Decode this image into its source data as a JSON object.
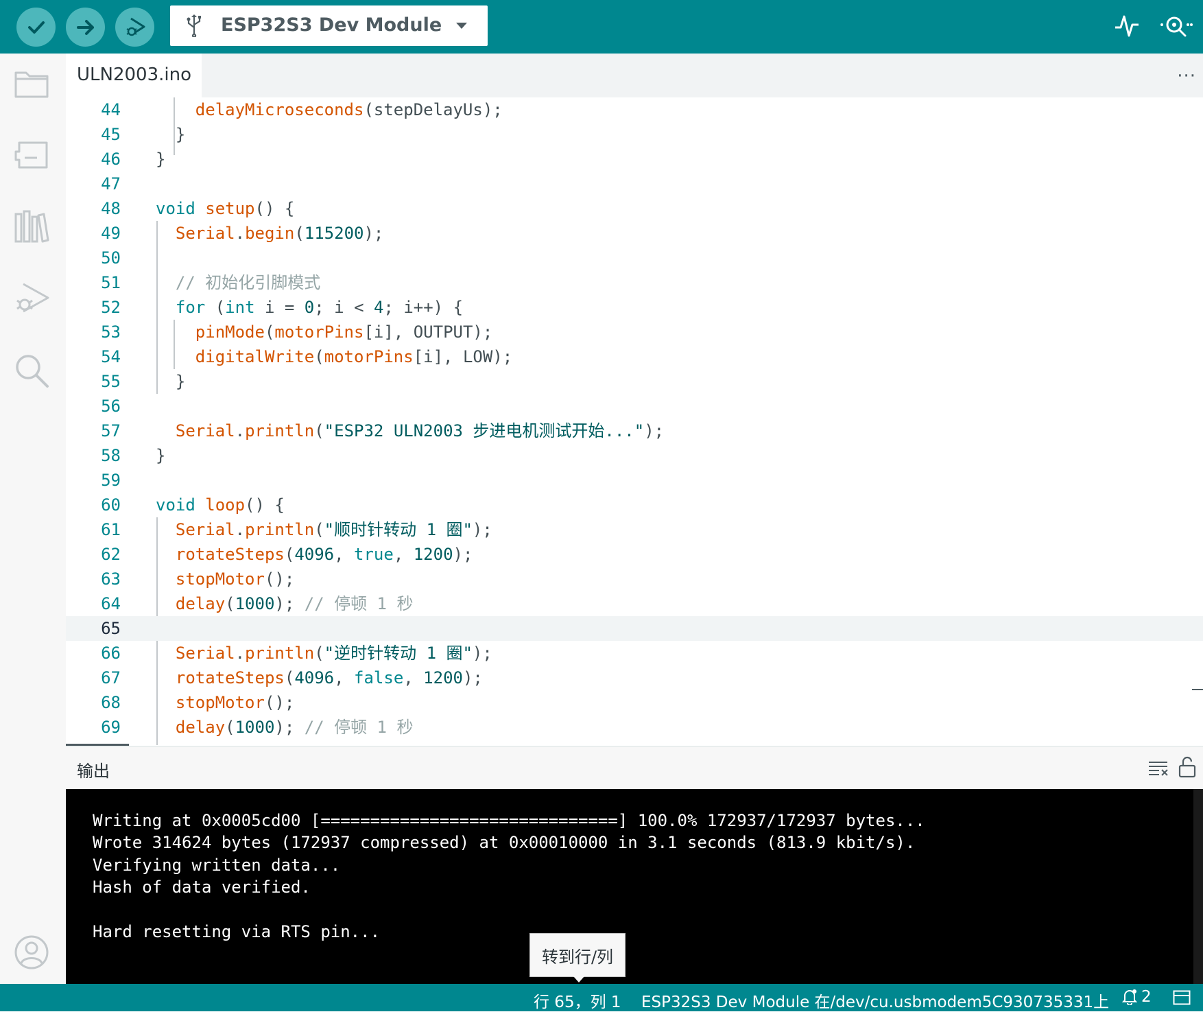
{
  "toolbar": {
    "board": "ESP32S3 Dev Module",
    "buttons": [
      "verify",
      "upload",
      "debug"
    ],
    "right_icons": [
      "serial-plotter",
      "serial-monitor"
    ]
  },
  "tabs": [
    {
      "label": "ULN2003.ino",
      "active": true
    }
  ],
  "editor": {
    "current_line": "65",
    "lines": [
      {
        "n": "44",
        "code": "    delayMicroseconds(stepDelayUs);"
      },
      {
        "n": "45",
        "code": "  }"
      },
      {
        "n": "46",
        "code": "}"
      },
      {
        "n": "47",
        "code": ""
      },
      {
        "n": "48",
        "code": "void setup() {"
      },
      {
        "n": "49",
        "code": "  Serial.begin(115200);"
      },
      {
        "n": "50",
        "code": ""
      },
      {
        "n": "51",
        "code": "  // 初始化引脚模式"
      },
      {
        "n": "52",
        "code": "  for (int i = 0; i < 4; i++) {"
      },
      {
        "n": "53",
        "code": "    pinMode(motorPins[i], OUTPUT);"
      },
      {
        "n": "54",
        "code": "    digitalWrite(motorPins[i], LOW);"
      },
      {
        "n": "55",
        "code": "  }"
      },
      {
        "n": "56",
        "code": ""
      },
      {
        "n": "57",
        "code": "  Serial.println(\"ESP32 ULN2003 步进电机测试开始...\");"
      },
      {
        "n": "58",
        "code": "}"
      },
      {
        "n": "59",
        "code": ""
      },
      {
        "n": "60",
        "code": "void loop() {"
      },
      {
        "n": "61",
        "code": "  Serial.println(\"顺时针转动 1 圈\");"
      },
      {
        "n": "62",
        "code": "  rotateSteps(4096, true, 1200);"
      },
      {
        "n": "63",
        "code": "  stopMotor();"
      },
      {
        "n": "64",
        "code": "  delay(1000); // 停顿 1 秒"
      },
      {
        "n": "65",
        "code": ""
      },
      {
        "n": "66",
        "code": "  Serial.println(\"逆时针转动 1 圈\");"
      },
      {
        "n": "67",
        "code": "  rotateSteps(4096, false, 1200);"
      },
      {
        "n": "68",
        "code": "  stopMotor();"
      },
      {
        "n": "69",
        "code": "  delay(1000); // 停顿 1 秒"
      }
    ]
  },
  "output": {
    "title": "输出",
    "lines": [
      "Writing at 0x0005cd00 [==============================] 100.0% 172937/172937 bytes...",
      "Wrote 314624 bytes (172937 compressed) at 0x00010000 in 3.1 seconds (813.9 kbit/s).",
      "Verifying written data...",
      "Hash of data verified.",
      "",
      "Hard resetting via RTS pin..."
    ]
  },
  "tooltip": "转到行/列",
  "status": {
    "position": "行 65，列 1",
    "board_port": "ESP32S3 Dev Module 在/dev/cu.usbmodem5C930735331上",
    "notifications": "2"
  },
  "colors": {
    "accent": "#00878f",
    "keyword": "#00878f",
    "function": "#d35400",
    "string": "#005c5f",
    "comment": "#95a5a6"
  }
}
